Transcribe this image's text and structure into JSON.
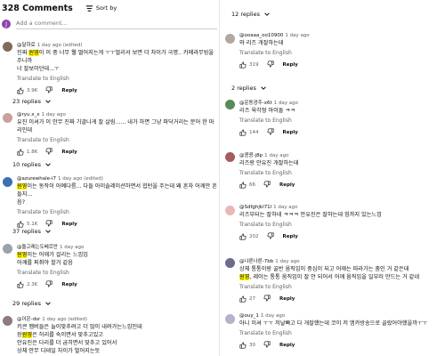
{
  "header": {
    "count": "328 Comments",
    "sort_label": "Sort by"
  },
  "add_comment": {
    "avatar_letter": "J",
    "placeholder": "Add a comment..."
  },
  "ui": {
    "translate_label": "Translate to English",
    "reply_label": "Reply"
  },
  "left_comments": [
    {
      "author": "@달하로",
      "time": "1 day ago (edited)",
      "avatar_color": "#7d6b5e",
      "lines": [
        "진짜 [원영]이 이 중 너무 웰 떨어지는게 ㅜㅜ멀리서 보면 더 차이가 극명.. 카메라무빙을 주니까",
        "너 잘보이던데...ㅜ"
      ],
      "likes": "3.9K",
      "replies": "23 replies"
    },
    {
      "author": "@ryu.x_x",
      "time": "1 day ago",
      "avatar_color": "#c9a09a",
      "lines": [
        "유진 이셔가 이 안무 진짜 기괄나게 잘 살림...... 내가 하면 그냥 파닥거리는 문어 한 마리인데"
      ],
      "likes": "1.8K",
      "replies": "10 replies"
    },
    {
      "author": "@azurewhale-i7",
      "time": "1 day ago (edited)",
      "avatar_color": "#3b6fb6",
      "lines": [
        "[원영]이는 동작이 아예다름... 다들 아이솔레이션하면서 힙턴을 주는데 왜 혼자 어깨만 흔들지...",
        "음?"
      ],
      "likes": "5.1K",
      "replies": "37 replies"
    },
    {
      "author": "@돌고래는도베르만",
      "time": "1 day ago",
      "avatar_color": "#9aa3ac",
      "lines": [
        "[원영]이는 어깨가 걸리는 느낌임",
        "어깨를 퍼취야 할거 같음"
      ],
      "likes": "2.3K",
      "replies": "29 replies"
    },
    {
      "author": "@이온-dsr",
      "time": "1 day ago (edited)",
      "avatar_color": "#8c7b7b",
      "lines": [
        "키큰 멤버들은 늘이맞추려고 더 많이 내려가는느낌인데",
        "장[원영]은 허리를 숙이면서 맞추고있고",
        "안유진은 다리를 더 굽히면서 맞추고 있어서",
        "상체 안무 디테일 차이가 벌어지는듯"
      ],
      "likes": "",
      "replies": ""
    }
  ],
  "right_top_replies": "12 replies",
  "right_comments": [
    {
      "author": "@ooaaa_oo10900",
      "time": "1 day ago",
      "avatar_color": "#b0a8a0",
      "lines": [
        "와 리즈 개잘하는데"
      ],
      "likes": "319",
      "replies": "2 replies"
    },
    {
      "author": "@운동광주-x6t",
      "time": "1 day ago",
      "avatar_color": "#5b8a5a",
      "lines": [
        "리즈 육각형 아이돌 ㅋㅋ"
      ],
      "likes": "144",
      "replies": ""
    },
    {
      "author": "@콩콩-j8p",
      "time": "1 day ago",
      "avatar_color": "#a45c5c",
      "lines": [
        "리즈랑 안유진 개잘하는데"
      ],
      "likes": "66",
      "replies": ""
    },
    {
      "author": "@Sdfghjkl71l",
      "time": "1 day ago",
      "avatar_color": "#e8b7b7",
      "lines": [
        "리즈부터는 잘하네 ㅋㅋㅋ 안유진은 잘하는데 힘까지 있는느낌"
      ],
      "likes": "202",
      "replies": ""
    },
    {
      "author": "@나른나른-7bb",
      "time": "1 day ago",
      "avatar_color": "#6c6c8a",
      "lines": [
        "상체 통통이랑 골반 움직임이 중심이 되고 어깨는 따라가는 춤인 거 같은데",
        "[원영], 레이는 통통 움직임이 잘 안 되어서 어깨 움직임을 일부러 만드는 거 같네"
      ],
      "likes": "27",
      "replies": ""
    },
    {
      "author": "@ouy_1",
      "time": "1 day ago",
      "avatar_color": "#b8b0c8",
      "lines": [
        "아니 이셔 ㅜㅜ 저날빠고 다 개잘했는데 코이 저 엠카방송으로 골랐어야했을까ㅜㅜ"
      ],
      "likes": "30",
      "replies": ""
    }
  ],
  "icons": {
    "like": "thumb-up-icon",
    "dislike": "thumb-down-icon",
    "sort": "sort-icon",
    "expand": "chevron-down-icon"
  }
}
